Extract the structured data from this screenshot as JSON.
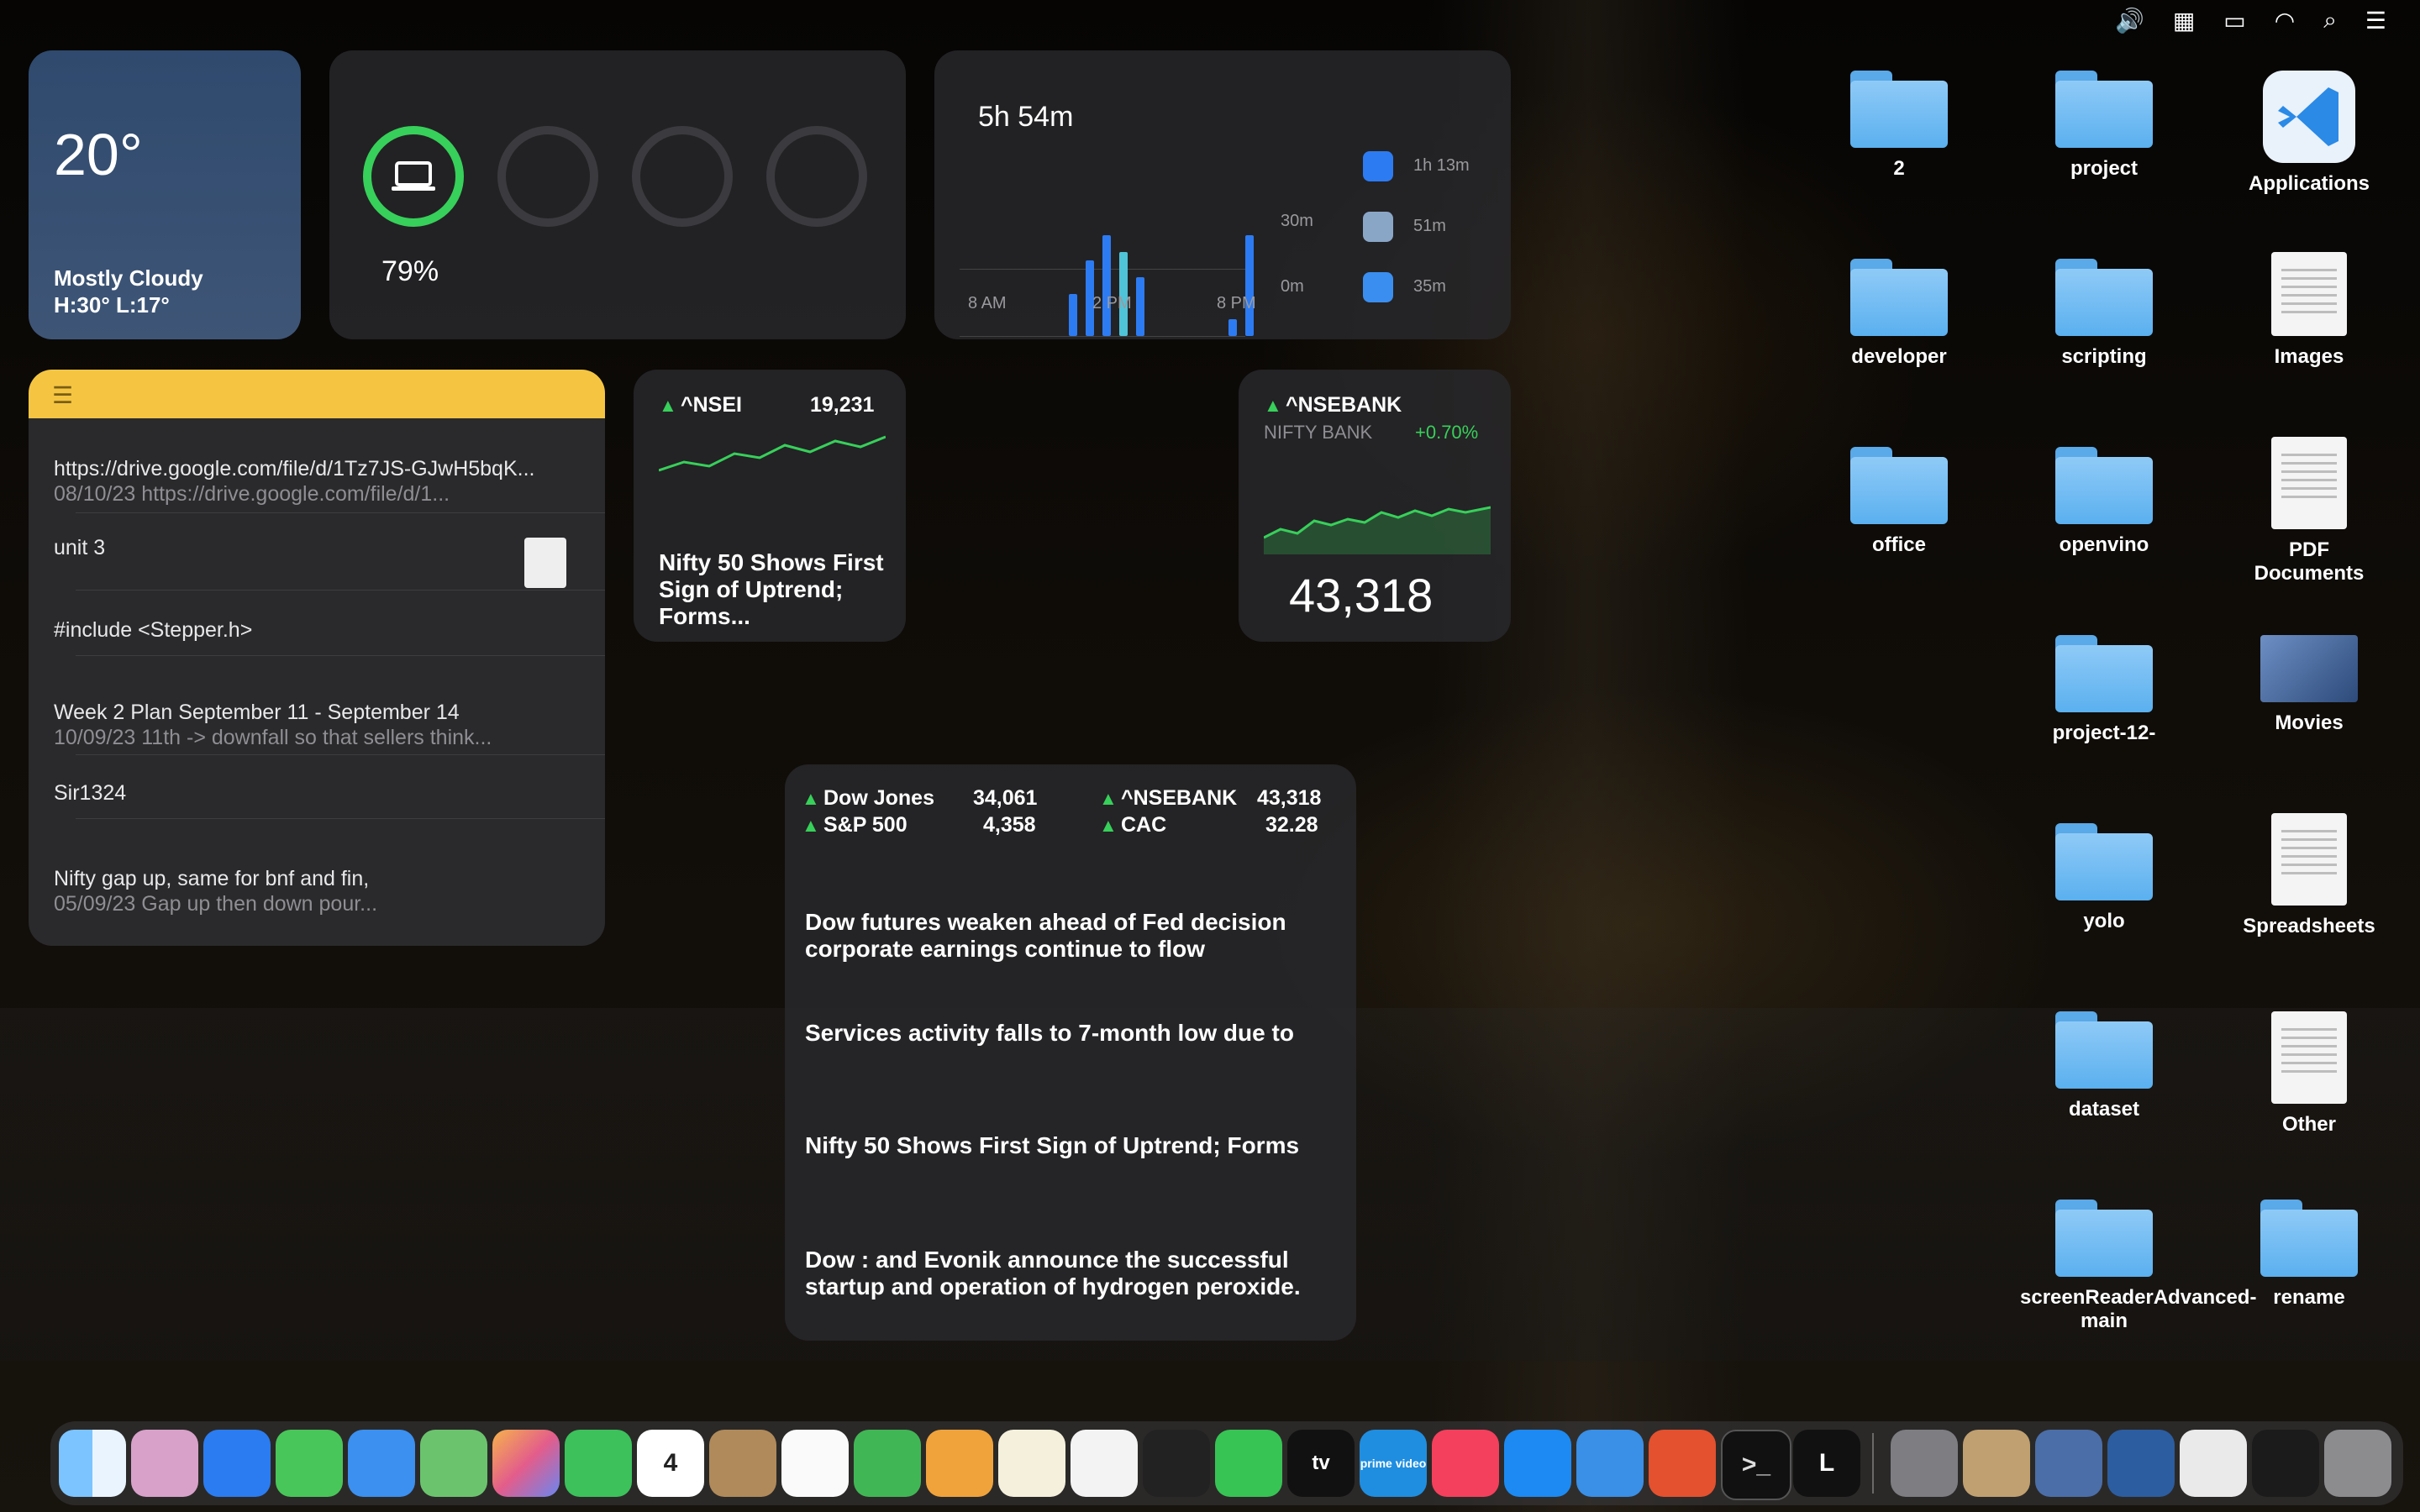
{
  "menubar": {
    "icons": [
      "apple-icon",
      "volume-icon",
      "calendar-icon",
      "battery-icon",
      "wifi-icon",
      "search-icon",
      "control-center-icon"
    ]
  },
  "weather": {
    "temp": "20°",
    "condition": "Mostly Cloudy",
    "range": "H:30° L:17°"
  },
  "battery": {
    "percent": "79%",
    "level": 0.79
  },
  "screentime": {
    "total": "5h 54m",
    "x_labels": [
      "8 AM",
      "2 PM",
      "8 PM"
    ],
    "y_labels": [
      "30m",
      "0m"
    ],
    "apps": [
      {
        "time": "1h 13m"
      },
      {
        "time": "51m"
      },
      {
        "time": "35m"
      }
    ]
  },
  "notes": {
    "items": [
      {
        "title": "https://drive.google.com/file/d/1Tz7JS-GJwH5bqK...",
        "sub": "08/10/23  https://drive.google.com/file/d/1..."
      },
      {
        "title": "unit 3",
        "sub": ""
      },
      {
        "title": "#include <Stepper.h>",
        "sub": ""
      },
      {
        "title": "Week 2 Plan September 11 - September 14",
        "sub": "10/09/23  11th -> downfall so that sellers think..."
      },
      {
        "title": "Sir1324",
        "sub": ""
      },
      {
        "title": "Nifty gap up, same for bnf and fin,",
        "sub": "05/09/23  Gap up then down pour..."
      }
    ]
  },
  "stock_small": {
    "symbol": "^NSEI",
    "value": "19,231",
    "headline": "Nifty 50 Shows First Sign of Uptrend; Forms..."
  },
  "stock_bank": {
    "symbol": "^NSEBANK",
    "name": "NIFTY BANK",
    "change": "+0.70%",
    "value": "43,318"
  },
  "stocks_list": [
    {
      "symbol": "Dow Jones",
      "value": "34,061"
    },
    {
      "symbol": "S&P 500",
      "value": "4,358"
    },
    {
      "symbol": "^NSEBANK",
      "value": "43,318"
    },
    {
      "symbol": "CAC",
      "value": "32.28"
    }
  ],
  "news": [
    "Dow futures weaken ahead of Fed decision corporate earnings continue to flow",
    "Services activity falls to 7-month low due to",
    "Nifty 50 Shows First Sign of Uptrend; Forms",
    "Dow : and Evonik announce the successful startup and operation of hydrogen peroxide."
  ],
  "desktop": [
    {
      "label": "2",
      "kind": "folder"
    },
    {
      "label": "project",
      "kind": "folder"
    },
    {
      "label": "Applications",
      "kind": "app"
    },
    {
      "label": "developer",
      "kind": "folder"
    },
    {
      "label": "scripting",
      "kind": "folder"
    },
    {
      "label": "Images",
      "kind": "doc"
    },
    {
      "label": "office",
      "kind": "folder"
    },
    {
      "label": "openvino",
      "kind": "folder"
    },
    {
      "label": "PDF Documents",
      "kind": "doc"
    },
    {
      "label": "project-12-",
      "kind": "folder"
    },
    {
      "label": "Movies",
      "kind": "doc"
    },
    {
      "label": "yolo",
      "kind": "folder"
    },
    {
      "label": "Spreadsheets",
      "kind": "doc"
    },
    {
      "label": "dataset",
      "kind": "folder"
    },
    {
      "label": "Other",
      "kind": "doc"
    },
    {
      "label": "screenReaderAdvanced-main",
      "kind": "folder"
    },
    {
      "label": "rename",
      "kind": "folder"
    }
  ],
  "dock": {
    "calendar_day": "4",
    "tv_label": "tv",
    "prime_label": "prime video",
    "letter_app": "L",
    "terminal_label": ">_"
  }
}
